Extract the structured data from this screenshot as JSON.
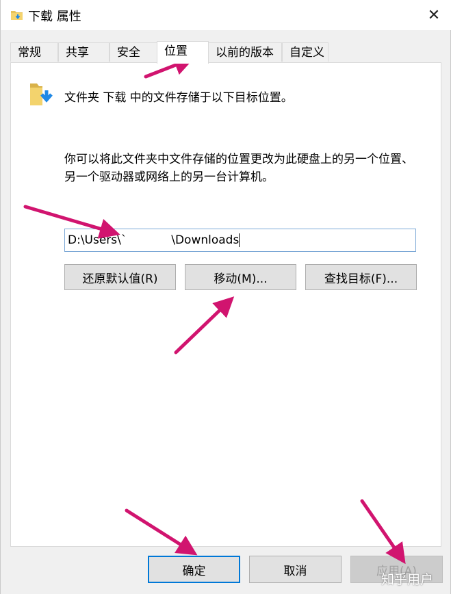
{
  "window": {
    "title": "下载 属性",
    "close_glyph": "✕"
  },
  "tabs": [
    {
      "label": "常规",
      "active": false
    },
    {
      "label": "共享",
      "active": false
    },
    {
      "label": "安全",
      "active": false
    },
    {
      "label": "位置",
      "active": true
    },
    {
      "label": "以前的版本",
      "active": false
    },
    {
      "label": "自定义",
      "active": false
    }
  ],
  "location": {
    "info": "文件夹 下载 中的文件存储于以下目标位置。",
    "description": "你可以将此文件夹中文件存储的位置更改为此硬盘上的另一个位置、另一个驱动器或网络上的另一台计算机。",
    "path_value": "D:\\Users\\`            \\Downloads",
    "buttons": {
      "restore": "还原默认值(R)",
      "move": "移动(M)...",
      "find_target": "查找目标(F)..."
    }
  },
  "footer": {
    "ok": "确定",
    "cancel": "取消",
    "apply": "应用(A)"
  },
  "watermark": "知乎用户",
  "colors": {
    "arrow": "#d1146f",
    "focus_border": "#0078d7",
    "folder": "#e8c35a",
    "download_arrow": "#1e88e5"
  }
}
